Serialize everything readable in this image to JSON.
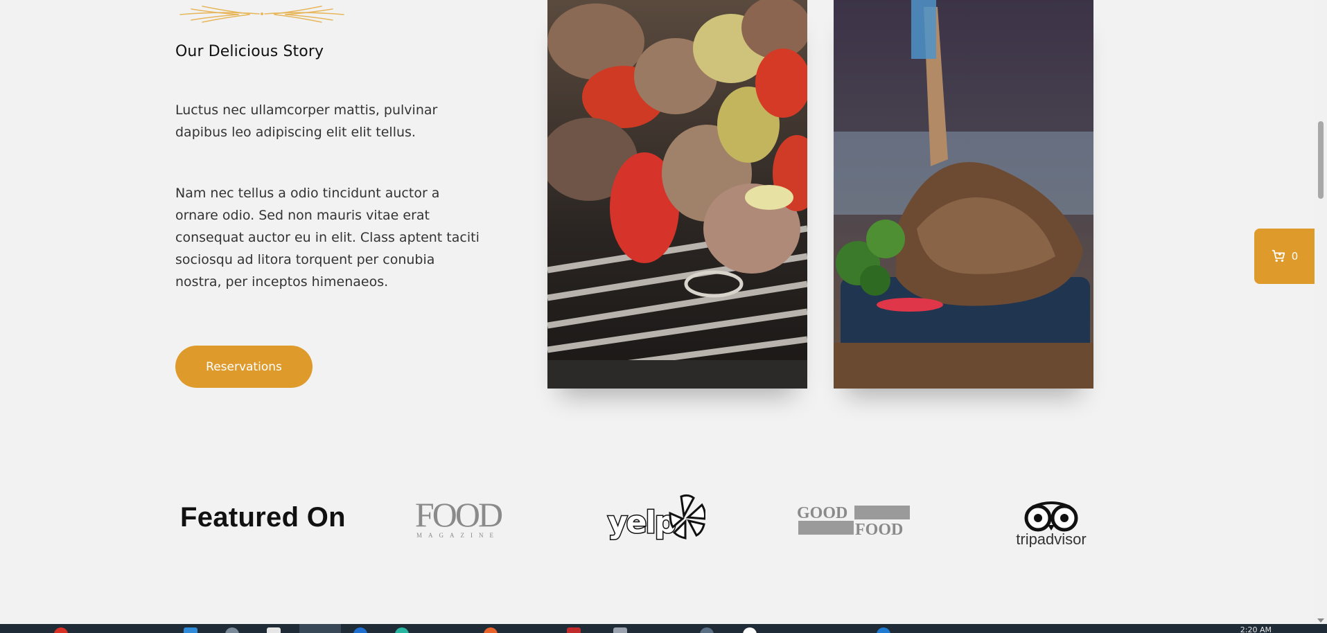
{
  "story": {
    "title": "Our Delicious Story",
    "paragraph1": "Luctus nec ullamcorper mattis, pulvinar dapibus leo adipiscing elit elit tellus.",
    "paragraph2": "Nam nec tellus a odio tincidunt auctor a ornare odio. Sed non mauris vitae erat consequat auctor eu in elit. Class aptent taciti sociosqu ad litora torquent per conubia nostra, per inceptos himenaeos.",
    "button_label": "Reservations"
  },
  "featured": {
    "heading": "Featured On",
    "logos": [
      {
        "name": "food-magazine-logo",
        "text": "FOOD",
        "subtext": "MAGAZINE"
      },
      {
        "name": "yelp-logo",
        "text": "yelp"
      },
      {
        "name": "good-food-logo",
        "text_top": "GOOD",
        "text_bottom": "FOOD"
      },
      {
        "name": "tripadvisor-logo",
        "text": "tripadvisor"
      }
    ]
  },
  "cart": {
    "icon": "cart-icon",
    "count": "0"
  },
  "taskbar": {
    "clock": "2:20 AM"
  },
  "colors": {
    "accent": "#df9a2c",
    "background": "#f2f2f2",
    "taskbar": "#1f2b36"
  }
}
